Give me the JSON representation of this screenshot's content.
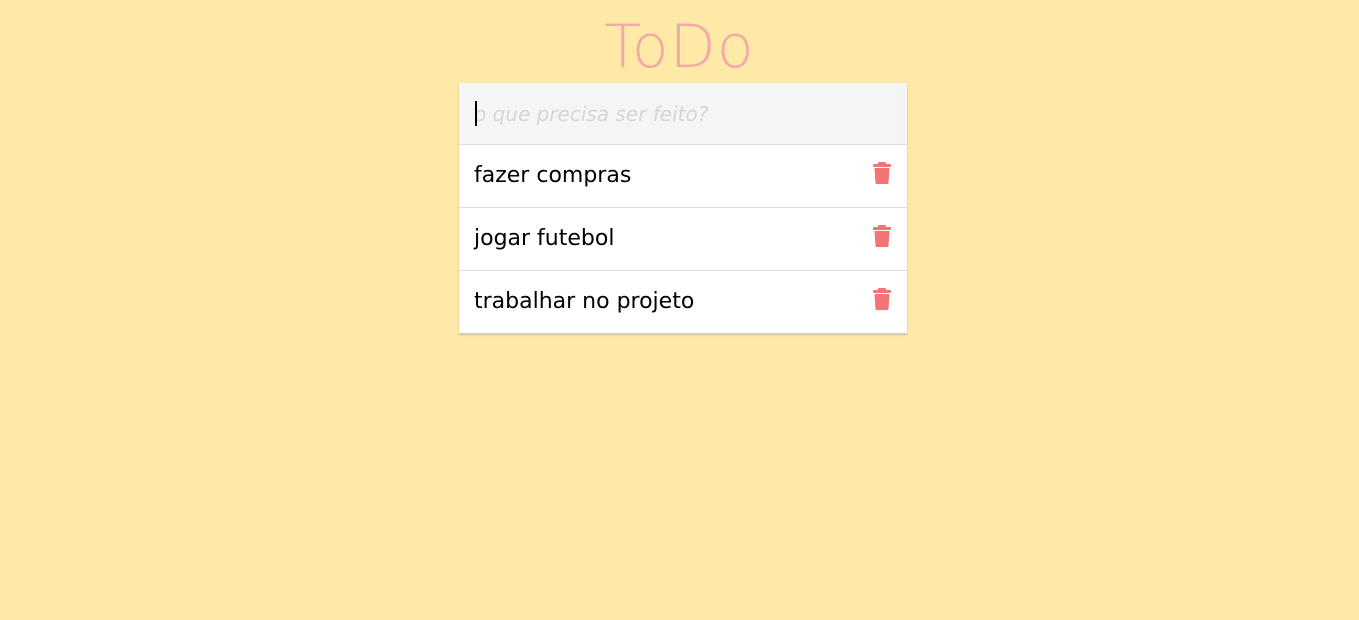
{
  "app": {
    "title": "ToDo"
  },
  "new_todo": {
    "placeholder": "o que precisa ser feito?",
    "value": ""
  },
  "todos": [
    {
      "text": "fazer compras",
      "action_icon": "trash-icon"
    },
    {
      "text": "jogar futebol",
      "action_icon": "trash-icon"
    },
    {
      "text": "trabalhar no projeto",
      "action_icon": "trash-icon"
    }
  ],
  "colors": {
    "background": "#ffe9a6",
    "title": "#f4a9a8",
    "trash": "#f27474",
    "input_background": "#f5f5f5"
  }
}
